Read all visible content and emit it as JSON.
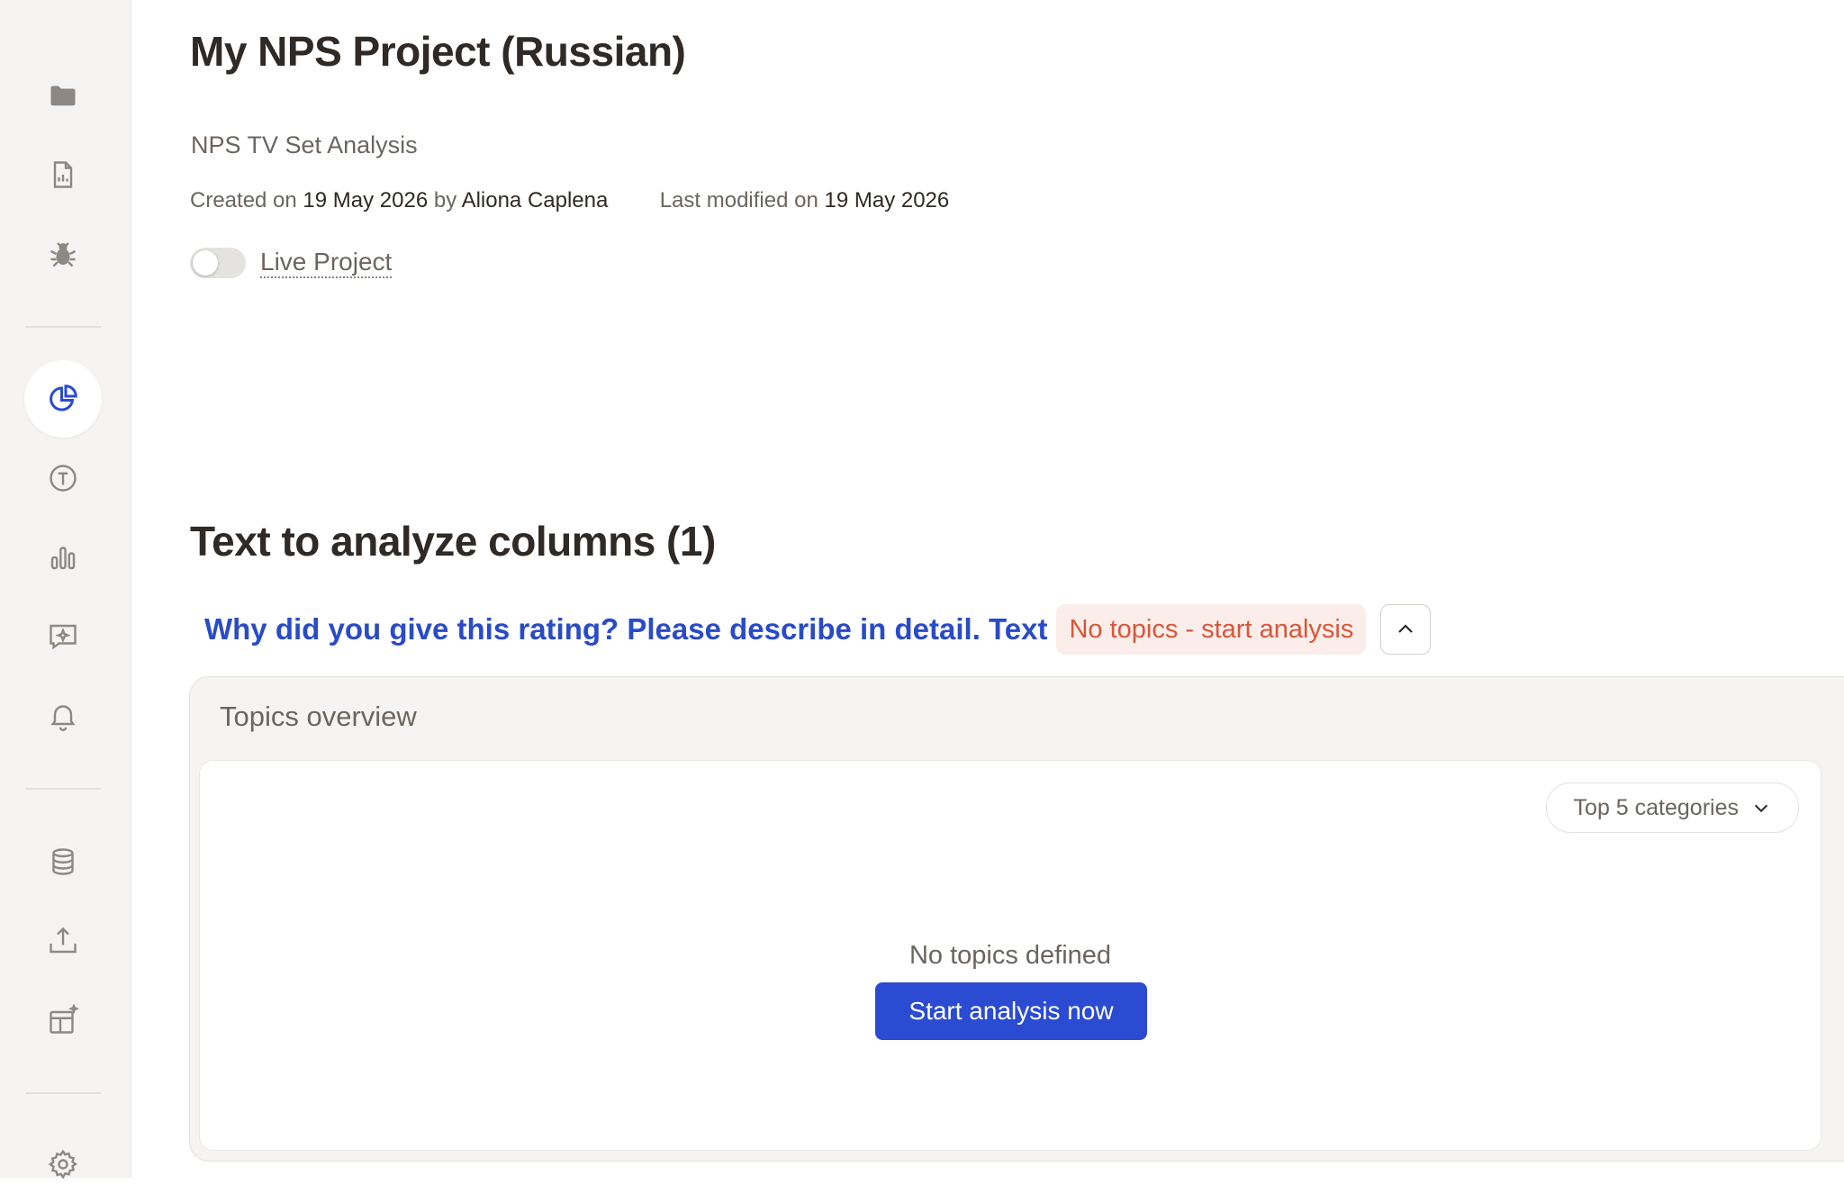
{
  "sidebar": {
    "items": [
      {
        "name": "projects",
        "icon": "folder-icon"
      },
      {
        "name": "reports",
        "icon": "report-document-icon"
      },
      {
        "name": "debug",
        "icon": "bug-icon"
      },
      {
        "name": "overview",
        "icon": "pie-chart-icon",
        "active": true
      },
      {
        "name": "topics",
        "icon": "topic-circle-t-icon"
      },
      {
        "name": "charts",
        "icon": "bar-chart-icon"
      },
      {
        "name": "feedback",
        "icon": "chat-sparkle-icon"
      },
      {
        "name": "alerts",
        "icon": "bell-icon"
      },
      {
        "name": "data",
        "icon": "database-icon"
      },
      {
        "name": "export",
        "icon": "upload-icon"
      },
      {
        "name": "layout",
        "icon": "layout-sparkle-icon"
      },
      {
        "name": "settings",
        "icon": "gear-icon"
      }
    ]
  },
  "project": {
    "title": "My NPS Project (Russian)",
    "subtitle": "NPS TV Set Analysis",
    "created_label": "Created on",
    "created_date": "19 May 2026",
    "by_label": "by",
    "author": "Aliona Caplena",
    "modified_label": "Last modified on",
    "modified_date": "19 May 2026",
    "live_label": "Live Project",
    "live_enabled": false
  },
  "section": {
    "title": "Text to analyze columns (1)"
  },
  "column": {
    "name": "Why did you give this rating? Please describe in detail. Text",
    "status": "No topics - start analysis"
  },
  "overview": {
    "title": "Topics overview",
    "select_label": "Top 5 categories",
    "empty_text": "No topics defined",
    "start_button": "Start analysis now"
  },
  "colors": {
    "accent": "#2a4bd2",
    "link": "#2a4bc8",
    "warning_text": "#d9553a",
    "warning_bg": "#fbeeea"
  }
}
